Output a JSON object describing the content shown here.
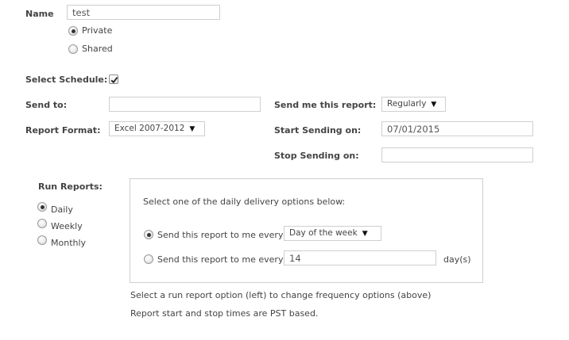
{
  "name": {
    "label": "Name",
    "value": "test"
  },
  "visibility": {
    "options": [
      {
        "label": "Private",
        "selected": true
      },
      {
        "label": "Shared",
        "selected": false
      }
    ]
  },
  "select_schedule": {
    "label": "Select Schedule:",
    "checked": true
  },
  "send_to": {
    "label": "Send to:",
    "value": ""
  },
  "send_me": {
    "label": "Send me this report:",
    "value": "Regularly"
  },
  "report_format": {
    "label": "Report Format:",
    "value": "Excel 2007-2012"
  },
  "start_sending": {
    "label": "Start Sending on:",
    "value": "07/01/2015"
  },
  "stop_sending": {
    "label": "Stop Sending on:",
    "value": ""
  },
  "run_reports": {
    "label": "Run Reports:",
    "options": [
      {
        "label": "Daily",
        "selected": true
      },
      {
        "label": "Weekly",
        "selected": false
      },
      {
        "label": "Monthly",
        "selected": false
      }
    ]
  },
  "daily_box": {
    "intro": "Select one of the daily delivery options below:",
    "option1": {
      "label": "Send this report to me every",
      "select_value": "Day of the week",
      "selected": true
    },
    "option2": {
      "label": "Send this report to me every",
      "input_value": "14",
      "unit": "day(s)",
      "selected": false
    }
  },
  "notes": {
    "line1": "Select a run report option (left) to change frequency options (above)",
    "line2": "Report start and stop times are PST based."
  },
  "colors": {
    "text": "#444444",
    "border": "#cfcfcf",
    "background": "#ffffff"
  }
}
